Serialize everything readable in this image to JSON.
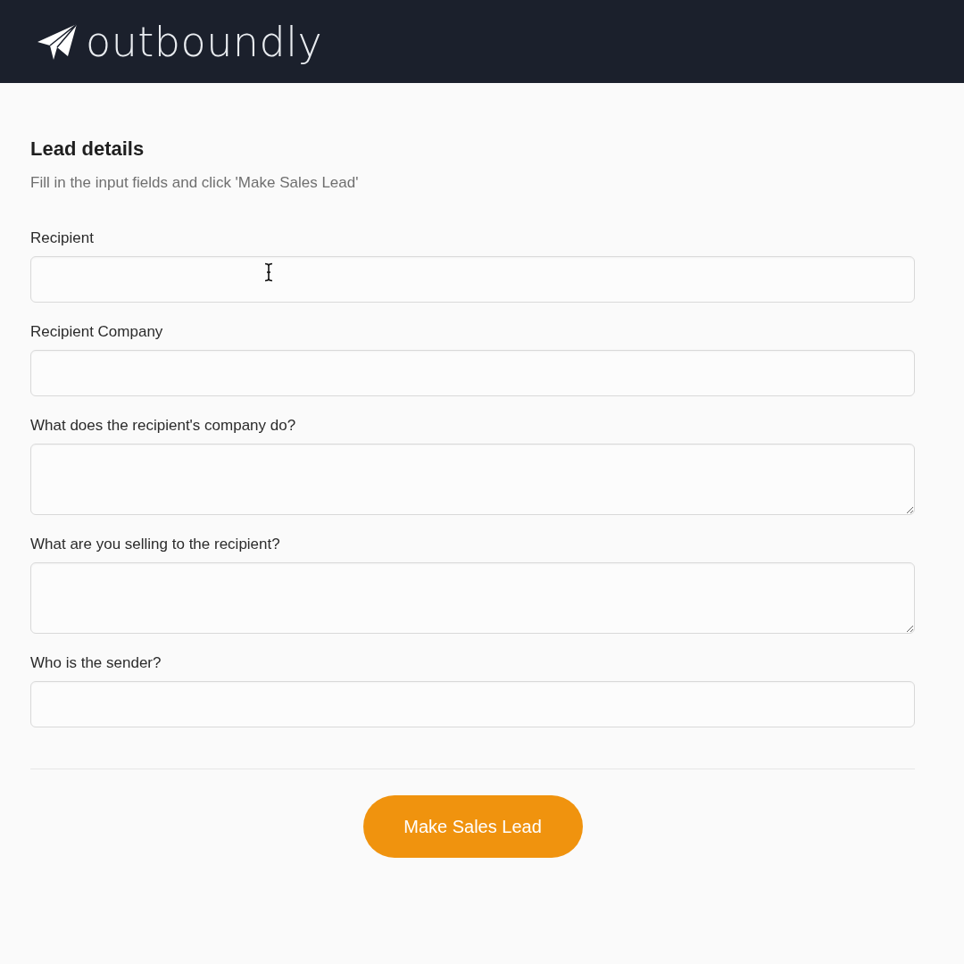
{
  "header": {
    "brand": "outboundly"
  },
  "form": {
    "title": "Lead details",
    "subtitle": "Fill in the input fields and click 'Make Sales Lead'",
    "fields": [
      {
        "kind": "input",
        "label": "Recipient",
        "hovered": true
      },
      {
        "kind": "input",
        "label": "Recipient Company",
        "hovered": false
      },
      {
        "kind": "textarea",
        "label": "What does the recipient's company do?",
        "hovered": false
      },
      {
        "kind": "textarea",
        "label": "What are you selling to the recipient?",
        "hovered": false
      },
      {
        "kind": "input",
        "label": "Who is the sender?",
        "hovered": false
      }
    ],
    "submit_button": "Make Sales Lead"
  }
}
